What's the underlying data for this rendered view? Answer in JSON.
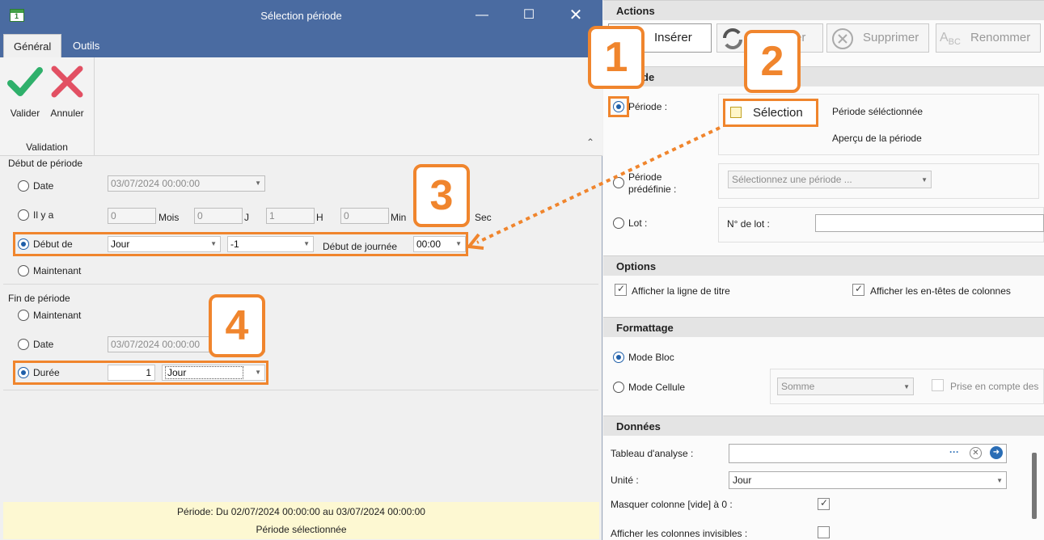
{
  "dialog": {
    "title": "Sélection période",
    "tabs": [
      "Général",
      "Outils"
    ],
    "ribbon": {
      "validate": "Valider",
      "cancel": "Annuler",
      "group": "Validation"
    },
    "start": {
      "section": "Début de période",
      "date_label": "Date",
      "date_value": "03/07/2024 00:00:00",
      "ago_label": "Il y a",
      "ago_months": "0",
      "ago_days": "0",
      "ago_hours": "1",
      "ago_minutes": "0",
      "unit_months": "Mois",
      "unit_days": "J",
      "unit_hours": "H",
      "unit_minutes": "Min",
      "unit_seconds": "Sec",
      "start_of_label": "Début de",
      "start_of_unit": "Jour",
      "start_of_offset": "-1",
      "day_start_label": "Début de journée",
      "day_start_time": "00:00",
      "now_label": "Maintenant"
    },
    "end": {
      "section": "Fin de période",
      "now_label": "Maintenant",
      "date_label": "Date",
      "date_value": "03/07/2024 00:00:00",
      "duration_label": "Durée",
      "duration_value": "1",
      "duration_unit": "Jour"
    },
    "status": {
      "line1": "Période: Du 02/07/2024 00:00:00 au 03/07/2024 00:00:00",
      "line2": "Période sélectionnée"
    }
  },
  "panel": {
    "actions": {
      "header": "Actions",
      "insert": "Insérer",
      "refresh_partial": "er",
      "delete": "Supprimer",
      "rename": "Renommer"
    },
    "period": {
      "header_partial": "de",
      "period_label": "Période :",
      "selection_button": "Sélection",
      "selected_text": "Période séléctionnée",
      "preview_text": "Aperçu de la période",
      "predefined_label_1": "Période",
      "predefined_label_2": "prédéfinie :",
      "predefined_placeholder": "Sélectionnez une période ...",
      "batch_label": "Lot :",
      "batch_number_label": "N° de lot :"
    },
    "options": {
      "header": "Options",
      "show_title_row": "Afficher la ligne de titre",
      "show_column_headers": "Afficher les en-têtes de colonnes"
    },
    "format": {
      "header": "Formattage",
      "block_mode": "Mode Bloc",
      "cell_mode": "Mode Cellule",
      "aggregate": "Somme",
      "take_into_account": "Prise en compte des"
    },
    "data": {
      "header": "Données",
      "analysis_table_label": "Tableau d'analyse :",
      "unit_label": "Unité :",
      "unit_value": "Jour",
      "hide_empty_label": "Masquer colonne [vide] à 0 :",
      "show_hidden_label": "Afficher les colonnes invisibles :"
    }
  },
  "callouts": [
    "1",
    "2",
    "3",
    "4"
  ],
  "colors": {
    "accent": "#f0852d",
    "titlebar": "#4a6ba1",
    "radio": "#1f5fa9"
  }
}
